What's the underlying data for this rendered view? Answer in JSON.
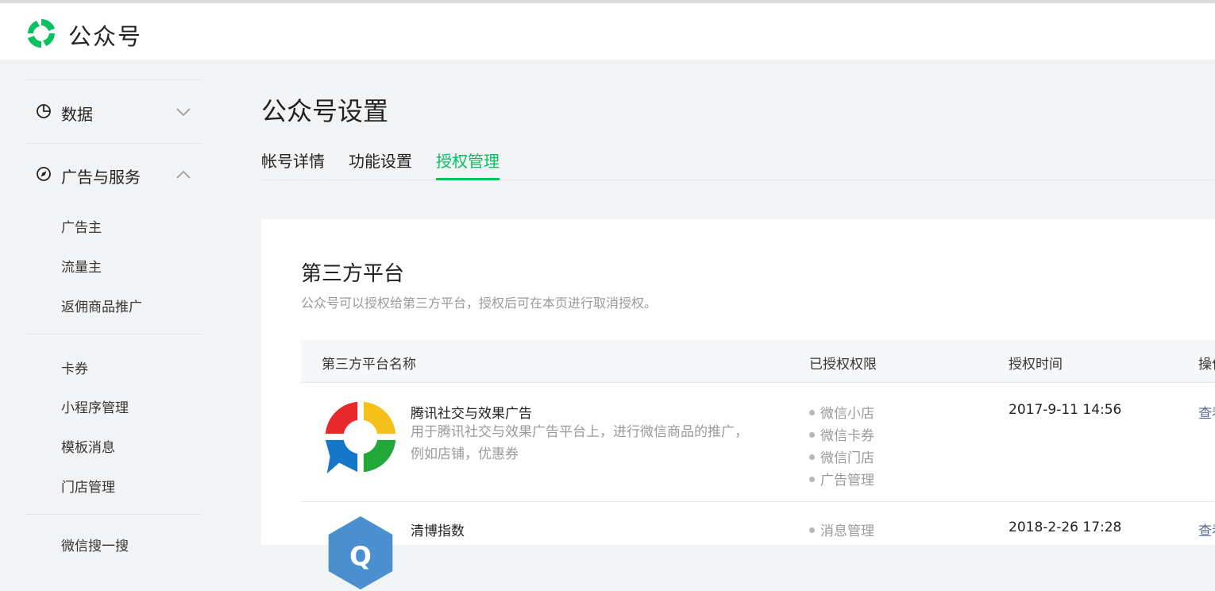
{
  "header": {
    "brand": "公众号",
    "logo_icon": "wechat-official-account-logo"
  },
  "sidebar": {
    "groups": [
      {
        "label": "数据",
        "icon": "pie-chart-icon",
        "expanded": false
      },
      {
        "label": "广告与服务",
        "icon": "compass-icon",
        "expanded": true
      }
    ],
    "items": [
      "广告主",
      "流量主",
      "返佣商品推广",
      "卡券",
      "小程序管理",
      "模板消息",
      "门店管理",
      "微信搜一搜"
    ]
  },
  "main": {
    "title": "公众号设置",
    "tabs": [
      {
        "label": "帐号详情",
        "active": false
      },
      {
        "label": "功能设置",
        "active": false
      },
      {
        "label": "授权管理",
        "active": true
      }
    ],
    "section": {
      "title": "第三方平台",
      "desc": "公众号可以授权给第三方平台，授权后可在本页进行取消授权。",
      "columns": [
        "第三方平台名称",
        "已授权权限",
        "授权时间",
        "操作"
      ],
      "rows": [
        {
          "name": "腾讯社交与效果广告",
          "desc": "用于腾讯社交与效果广告平台上，进行微信商品的推广，例如店铺，优惠券",
          "permissions": [
            "微信小店",
            "微信卡券",
            "微信门店",
            "广告管理"
          ],
          "time": "2017-9-11 14:56",
          "action": "查看"
        },
        {
          "name": "清博指数",
          "desc": "",
          "permissions": [
            "消息管理"
          ],
          "time": "2018-2-26 17:28",
          "action": "查看"
        }
      ]
    }
  },
  "colors": {
    "accent": "#07c160",
    "link": "#576b95",
    "muted": "#9a9a9a"
  }
}
